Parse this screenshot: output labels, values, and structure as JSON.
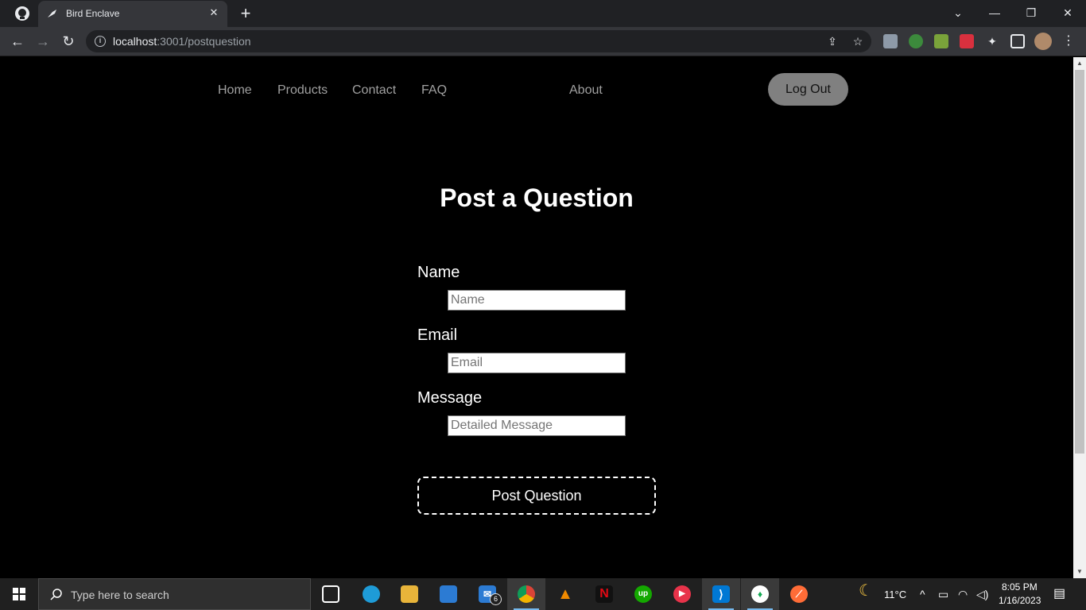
{
  "browser": {
    "tab_title": "Bird Enclave",
    "url_host": "localhost",
    "url_path": ":3001/postquestion"
  },
  "nav": {
    "links": [
      "Home",
      "Products",
      "Contact",
      "FAQ",
      "About"
    ],
    "logout_label": "Log Out"
  },
  "form": {
    "heading": "Post a Question",
    "name_label": "Name",
    "name_placeholder": "Name",
    "email_label": "Email",
    "email_placeholder": "Email",
    "message_label": "Message",
    "message_placeholder": "Detailed Message",
    "submit_label": "Post Question"
  },
  "taskbar": {
    "search_placeholder": "Type here to search",
    "mail_badge": "6",
    "weather": "11°C",
    "time": "8:05 PM",
    "date": "1/16/2023"
  },
  "colors": {
    "page_bg": "#000000",
    "logout_bg": "#808080",
    "nav_link": "#a0a0a0"
  }
}
